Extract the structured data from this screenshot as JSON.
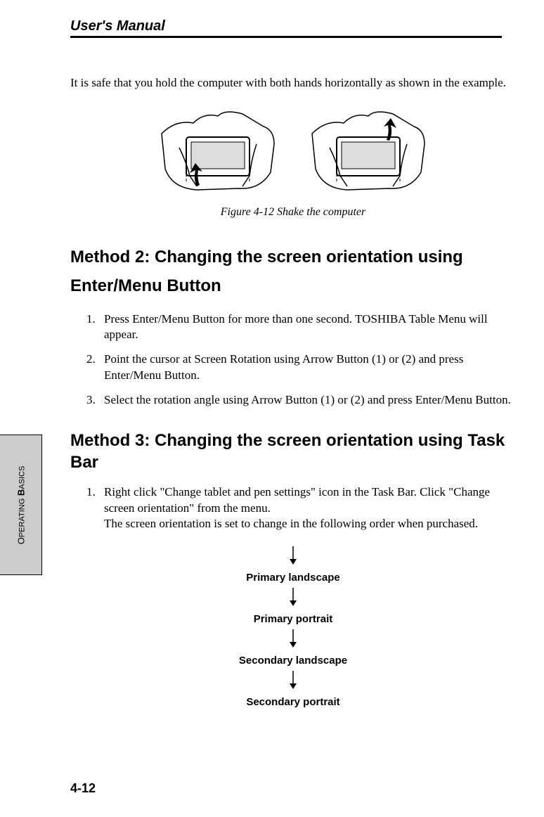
{
  "header": {
    "title": "User's Manual"
  },
  "intro": "It is safe that you hold the computer with both hands horizontally as shown in the example.",
  "figure_caption": "Figure 4-12  Shake the computer",
  "method2_heading": "Method 2: Changing the screen orientation using Enter/Menu Button",
  "method2_steps": [
    "Press Enter/Menu Button for more than one second. TOSHIBA Table Menu will appear.",
    "Point the cursor at Screen Rotation using Arrow Button (1) or (2) and press Enter/Menu Button.",
    "Select the rotation angle using Arrow Button (1) or (2) and press Enter/Menu Button."
  ],
  "method3_heading": "Method 3: Changing the screen orientation using Task Bar",
  "method3_step1_a": "Right click \"Change tablet and pen settings\" icon in the Task Bar. Click \"Change screen orientation\" from the menu.",
  "method3_step1_b": "The screen orientation is set to change in the following order when purchased.",
  "diagram": {
    "items": [
      "Primary landscape",
      "Primary portrait",
      "Secondary landscape",
      "Secondary portrait"
    ]
  },
  "side_tab": {
    "prefix": "O",
    "word1": "PERATING",
    "bold": " B",
    "word2": "ASICS"
  },
  "page_number": "4-12"
}
